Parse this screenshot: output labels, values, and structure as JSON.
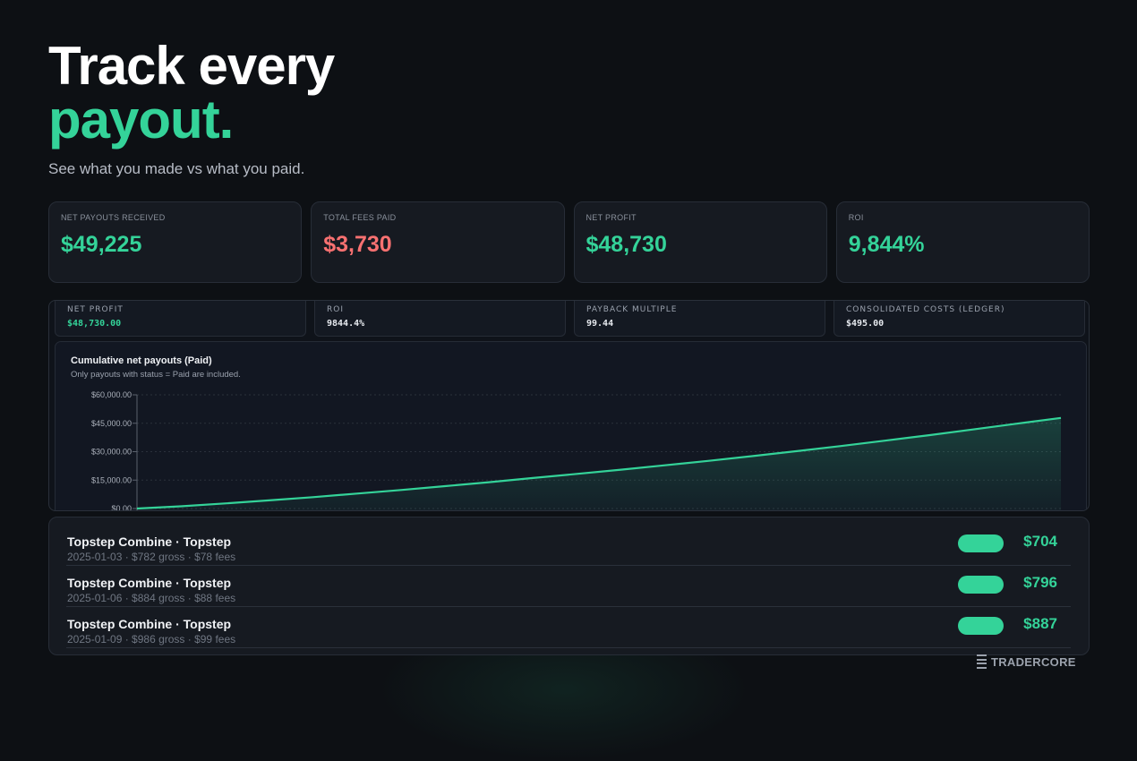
{
  "hero": {
    "line1": "Track every",
    "line2": "payout.",
    "subtitle": "See what you made vs what you paid."
  },
  "stats": [
    {
      "label": "NET PAYOUTS RECEIVED",
      "value": "$49,225",
      "tone": "green"
    },
    {
      "label": "TOTAL FEES PAID",
      "value": "$3,730",
      "tone": "red"
    },
    {
      "label": "NET PROFIT",
      "value": "$48,730",
      "tone": "green"
    },
    {
      "label": "ROI",
      "value": "9,844%",
      "tone": "green"
    }
  ],
  "screenshot": {
    "mini_stats": [
      {
        "label": "NET PROFIT",
        "value": "$48,730.00",
        "tone": "green"
      },
      {
        "label": "ROI",
        "value": "9844.4%",
        "tone": "white"
      },
      {
        "label": "PAYBACK MULTIPLE",
        "value": "99.44",
        "tone": "white"
      },
      {
        "label": "CONSOLIDATED COSTS (LEDGER)",
        "value": "$495.00",
        "tone": "white"
      }
    ],
    "chart_title": "Cumulative net payouts (Paid)",
    "chart_subtitle": "Only payouts with status = Paid are included."
  },
  "chart_data": {
    "type": "area",
    "title": "Cumulative net payouts (Paid)",
    "subtitle": "Only payouts with status = Paid are included.",
    "yticks": [
      "$0.00",
      "$15,000.00",
      "$30,000.00",
      "$45,000.00",
      "$60,000.00"
    ],
    "ylim": [
      0,
      60000
    ],
    "grid": true,
    "x": [
      0,
      1,
      2,
      3,
      4,
      5,
      6,
      7,
      8,
      9,
      10,
      11,
      12,
      13,
      14,
      15,
      16,
      17,
      18,
      19,
      20
    ],
    "values": [
      0,
      1200,
      2700,
      4300,
      6000,
      7900,
      9800,
      11800,
      13900,
      16100,
      18300,
      20500,
      22800,
      25200,
      27700,
      30300,
      33000,
      35800,
      38700,
      41700,
      44800,
      47800
    ]
  },
  "payouts": [
    {
      "title": "Topstep Combine · Topstep",
      "meta": "2025-01-03  ·  $782 gross · $78 fees",
      "amount": "$704"
    },
    {
      "title": "Topstep Combine · Topstep",
      "meta": "2025-01-06  ·  $884 gross · $88 fees",
      "amount": "$796"
    },
    {
      "title": "Topstep Combine · Topstep",
      "meta": "2025-01-09  ·  $986 gross · $99 fees",
      "amount": "$887"
    }
  ],
  "brand": {
    "name": "TRADERCORE",
    "icon": "stack-bars-icon"
  },
  "colors": {
    "accent": "#34d399",
    "negative": "#f87171",
    "background": "#0d1014",
    "card": "#161a21"
  }
}
